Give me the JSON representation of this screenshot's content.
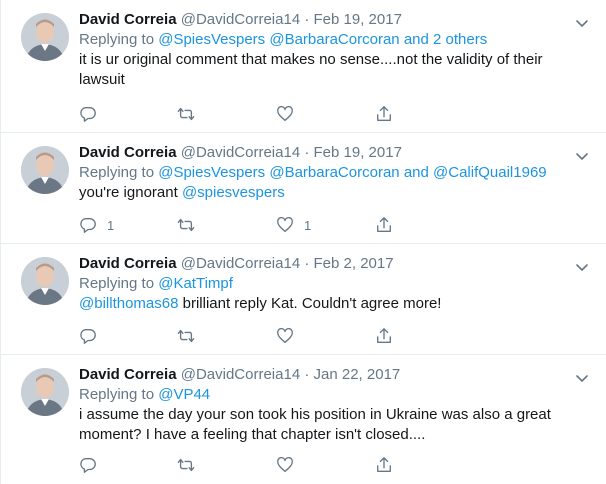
{
  "tweets": [
    {
      "name": "David Correia",
      "handle": "@DavidCorreia14",
      "separator": "·",
      "date": "Feb 19, 2017",
      "replying_prefix": "Replying to",
      "replying_links": [
        "@SpiesVespers",
        "@BarbaraCorcoran"
      ],
      "replying_suffix_and": "and",
      "replying_suffix_tail": "2 others",
      "text": "it is ur original comment that makes no sense....not the validity of their lawsuit",
      "reply_count": "",
      "like_count": ""
    },
    {
      "name": "David Correia",
      "handle": "@DavidCorreia14",
      "separator": "·",
      "date": "Feb 19, 2017",
      "replying_prefix": "Replying to",
      "replying_links": [
        "@SpiesVespers",
        "@BarbaraCorcoran"
      ],
      "replying_suffix_and": "and",
      "replying_suffix_tail": "@CalifQuail1969",
      "text_before_link": "you're ignorant",
      "text_link": "@spiesvespers",
      "reply_count": "1",
      "like_count": "1"
    },
    {
      "name": "David Correia",
      "handle": "@DavidCorreia14",
      "separator": "·",
      "date": "Feb 2, 2017",
      "replying_prefix": "Replying to",
      "replying_links": [
        "@KatTimpf"
      ],
      "text_link": "@billthomas68",
      "text_after_link": "brilliant reply Kat. Couldn't agree more!",
      "reply_count": "",
      "like_count": ""
    },
    {
      "name": "David Correia",
      "handle": "@DavidCorreia14",
      "separator": "·",
      "date": "Jan 22, 2017",
      "replying_prefix": "Replying to",
      "replying_links": [
        "@VP44"
      ],
      "text": "i assume the day your son took his position in Ukraine was also a great moment? I have a feeling that chapter isn't closed....",
      "reply_count": "",
      "like_count": ""
    }
  ],
  "icons": {
    "reply": "reply-icon",
    "retweet": "retweet-icon",
    "like": "heart-icon",
    "share": "share-icon",
    "menu": "chevron-down-icon"
  },
  "colors": {
    "link": "#1b95e0",
    "muted": "#657786",
    "text": "#14171a",
    "divider": "#e6ecf0"
  }
}
